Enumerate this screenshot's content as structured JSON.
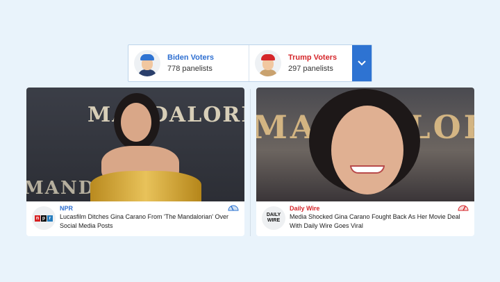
{
  "selector": {
    "left": {
      "name": "Biden Voters",
      "count": "778 panelists"
    },
    "right": {
      "name": "Trump Voters",
      "count": "297 panelists"
    }
  },
  "cards": [
    {
      "photo_text": "MANDALORIAN",
      "source": "NPR",
      "logo_letters": [
        "n",
        "p",
        "r"
      ],
      "headline": "Lucasfilm Ditches Gina Carano From 'The Mandalorian' Over Social Media Posts"
    },
    {
      "photo_text": "MANDALORIAN",
      "source": "Daily Wire",
      "logo_text": "DAILY WIRE",
      "headline": "Media Shocked Gina Carano Fought Back As Her Movie Deal With Daily Wire Goes Viral"
    }
  ],
  "colors": {
    "accent_blue": "#2e73d2",
    "biden_blue": "#2e6fd1",
    "trump_red": "#d5262a",
    "npr_red": "#d62021",
    "npr_black": "#000000",
    "npr_blue": "#237bbd"
  },
  "icons": {
    "dropdown": "chevron-down-icon",
    "bias_left": "bias-meter-left-icon",
    "bias_right": "bias-meter-right-icon"
  }
}
